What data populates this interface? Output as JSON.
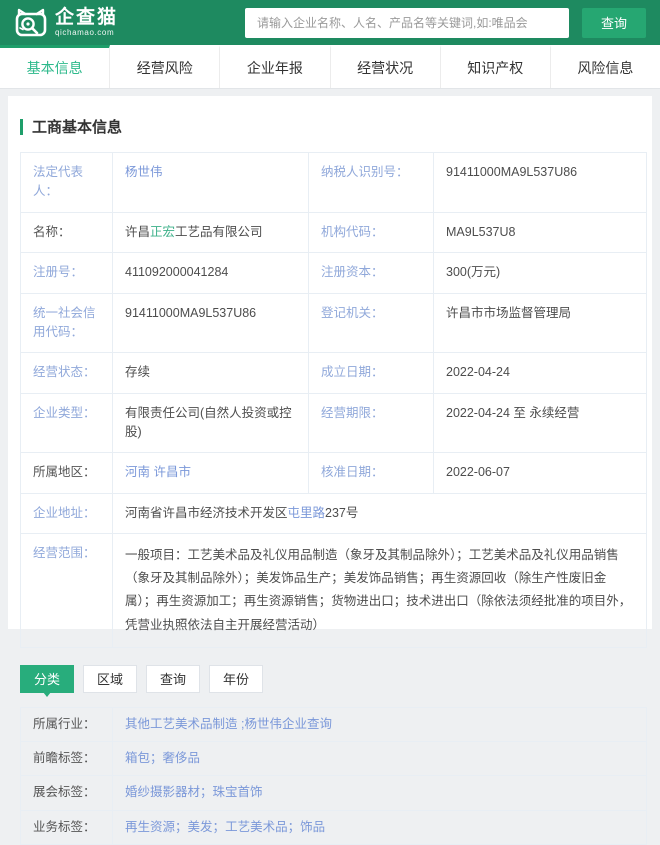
{
  "brand": {
    "name": "企查猫",
    "domain": "qichamao.com"
  },
  "search": {
    "placeholder": "请输入企业名称、人名、产品名等关键词,如:唯品会",
    "button_label": "查询"
  },
  "nav_tabs": [
    {
      "label": "基本信息",
      "active": true
    },
    {
      "label": "经营风险",
      "active": false
    },
    {
      "label": "企业年报",
      "active": false
    },
    {
      "label": "经营状况",
      "active": false
    },
    {
      "label": "知识产权",
      "active": false
    },
    {
      "label": "风险信息",
      "active": false
    }
  ],
  "section": {
    "title": "工商基本信息"
  },
  "info_table": {
    "rows": [
      {
        "cells": [
          {
            "label": "法定代表人：",
            "dark": false,
            "value": [
              {
                "t": "杨世伟",
                "s": "link"
              }
            ]
          },
          {
            "label": "纳税人识别号：",
            "dark": false,
            "value": [
              {
                "t": "91411000MA9L537U86",
                "s": "plain"
              }
            ]
          }
        ]
      },
      {
        "cells": [
          {
            "label": "名称：",
            "dark": true,
            "value": [
              {
                "t": "许昌",
                "s": "plain"
              },
              {
                "t": "正宏",
                "s": "highlight"
              },
              {
                "t": "工艺品有限公司",
                "s": "plain"
              }
            ]
          },
          {
            "label": "机构代码：",
            "dark": false,
            "value": [
              {
                "t": "MA9L537U8",
                "s": "plain"
              }
            ]
          }
        ]
      },
      {
        "cells": [
          {
            "label": "注册号：",
            "dark": false,
            "value": [
              {
                "t": "411092000041284",
                "s": "plain"
              }
            ]
          },
          {
            "label": "注册资本：",
            "dark": false,
            "value": [
              {
                "t": "300(万元)",
                "s": "plain"
              }
            ]
          }
        ]
      },
      {
        "cells": [
          {
            "label": "统一社会信用代码：",
            "dark": false,
            "value": [
              {
                "t": "91411000MA9L537U86",
                "s": "plain"
              }
            ]
          },
          {
            "label": "登记机关：",
            "dark": false,
            "value": [
              {
                "t": "许昌市市场监督管理局",
                "s": "plain"
              }
            ]
          }
        ]
      },
      {
        "cells": [
          {
            "label": "经营状态：",
            "dark": false,
            "value": [
              {
                "t": "存续",
                "s": "plain"
              }
            ]
          },
          {
            "label": "成立日期：",
            "dark": false,
            "value": [
              {
                "t": "2022-04-24",
                "s": "plain"
              }
            ]
          }
        ]
      },
      {
        "cells": [
          {
            "label": "企业类型：",
            "dark": false,
            "value": [
              {
                "t": "有限责任公司(自然人投资或控股)",
                "s": "plain"
              }
            ]
          },
          {
            "label": "经营期限：",
            "dark": false,
            "value": [
              {
                "t": "2022-04-24 至 永续经营",
                "s": "plain"
              }
            ]
          }
        ]
      },
      {
        "cells": [
          {
            "label": "所属地区：",
            "dark": true,
            "value": [
              {
                "t": "河南 许昌市",
                "s": "link"
              }
            ]
          },
          {
            "label": "核准日期：",
            "dark": false,
            "value": [
              {
                "t": "2022-06-07",
                "s": "plain"
              }
            ]
          }
        ]
      },
      {
        "cells": [
          {
            "label": "企业地址：",
            "dark": false,
            "value": [
              {
                "t": "河南省许昌市经济技术开发区",
                "s": "plain"
              },
              {
                "t": "屯里路",
                "s": "link"
              },
              {
                "t": "237号",
                "s": "plain"
              }
            ]
          }
        ]
      },
      {
        "cells": [
          {
            "label": "经营范围：",
            "dark": false,
            "scope": true,
            "value": [
              {
                "t": "一般项目：工艺美术品及礼仪用品制造（象牙及其制品除外）；工艺美术品及礼仪用品销售（象牙及其制品除外）；美发饰品生产；美发饰品销售；再生资源回收（除生产性废旧金属）；再生资源加工；再生资源销售；货物进出口；技术进出口（除依法须经批准的项目外，凭营业执照依法自主开展经营活动）",
                "s": "plain"
              }
            ]
          }
        ]
      }
    ]
  },
  "sub_tabs": [
    {
      "label": "分类",
      "active": true
    },
    {
      "label": "区域",
      "active": false
    },
    {
      "label": "查询",
      "active": false
    },
    {
      "label": "年份",
      "active": false
    }
  ],
  "tags_table": {
    "rows": [
      {
        "label": "所属行业：",
        "value": [
          {
            "t": "其他工艺美术品制造",
            "s": "link"
          },
          {
            "t": " ;",
            "s": "sep"
          },
          {
            "t": "杨世伟企业查询",
            "s": "link"
          }
        ]
      },
      {
        "label": "前瞻标签：",
        "value": [
          {
            "t": "箱包",
            "s": "link"
          },
          {
            "t": "；",
            "s": "sep"
          },
          {
            "t": "奢侈品",
            "s": "link"
          }
        ]
      },
      {
        "label": "展会标签：",
        "value": [
          {
            "t": "婚纱摄影器材",
            "s": "link"
          },
          {
            "t": "；",
            "s": "sep"
          },
          {
            "t": "珠宝首饰",
            "s": "link"
          }
        ]
      },
      {
        "label": "业务标签：",
        "value": [
          {
            "t": "再生资源",
            "s": "link"
          },
          {
            "t": "；",
            "s": "sep"
          },
          {
            "t": "美发",
            "s": "link"
          },
          {
            "t": "；",
            "s": "sep"
          },
          {
            "t": "工艺美术品",
            "s": "link"
          },
          {
            "t": "；",
            "s": "sep"
          },
          {
            "t": "饰品",
            "s": "link"
          }
        ]
      }
    ]
  },
  "colors": {
    "header_green": "#1e8a60",
    "button_green": "#26a772",
    "active_tab_green": "#2cb98b",
    "keyword_highlight_green": "#3cb089",
    "label_blue": "#90a8da",
    "link_blue": "#7b98d9",
    "dark_text": "#4d4d4d",
    "table_border": "#e8eef4",
    "page_background": "#eef0f2"
  }
}
